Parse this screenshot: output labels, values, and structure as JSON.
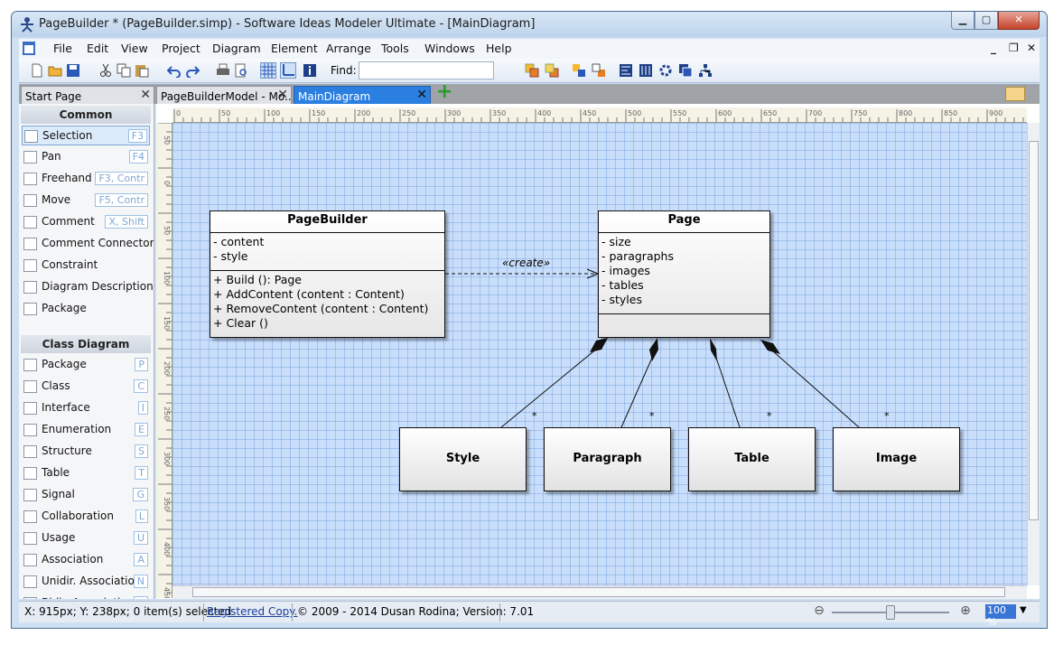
{
  "window": {
    "title": "PageBuilder * (PageBuilder.simp) - Software Ideas Modeler Ultimate - [MainDiagram]"
  },
  "menu": {
    "items": [
      "File",
      "Edit",
      "View",
      "Project",
      "Diagram",
      "Element",
      "Arrange",
      "Tools",
      "Windows",
      "Help"
    ],
    "mdi_min": "_",
    "mdi_restore": "❐",
    "mdi_close": "✕"
  },
  "toolbar": {
    "find_label": "Find:",
    "find_value": ""
  },
  "tabs": [
    {
      "label": "Start Page"
    },
    {
      "label": "PageBuilderModel - Mo..."
    },
    {
      "label": "MainDiagram"
    }
  ],
  "toolbox": {
    "common_header": "Common",
    "common": [
      {
        "label": "Selection",
        "key": "F3",
        "icon": "arrow-icon"
      },
      {
        "label": "Pan",
        "key": "F4",
        "icon": "pan-icon"
      },
      {
        "label": "Freehand Pa",
        "key": "F3, Contr",
        "icon": "freehand-icon"
      },
      {
        "label": "Move",
        "key": "F5, Contr",
        "icon": "move-icon"
      },
      {
        "label": "Comment",
        "key": "X, Shift",
        "icon": "comment-icon"
      },
      {
        "label": "Comment Connector",
        "key": "",
        "icon": "connector-icon"
      },
      {
        "label": "Constraint",
        "key": "",
        "icon": "constraint-icon"
      },
      {
        "label": "Diagram Description",
        "key": "",
        "icon": "description-icon"
      },
      {
        "label": "Package",
        "key": "",
        "icon": "package-icon"
      }
    ],
    "class_header": "Class Diagram",
    "class": [
      {
        "label": "Package",
        "key": "P",
        "icon": "package-icon"
      },
      {
        "label": "Class",
        "key": "C",
        "icon": "class-icon"
      },
      {
        "label": "Interface",
        "key": "I",
        "icon": "interface-icon"
      },
      {
        "label": "Enumeration",
        "key": "E",
        "icon": "enumeration-icon"
      },
      {
        "label": "Structure",
        "key": "S",
        "icon": "structure-icon"
      },
      {
        "label": "Table",
        "key": "T",
        "icon": "table-icon"
      },
      {
        "label": "Signal",
        "key": "G",
        "icon": "signal-icon"
      },
      {
        "label": "Collaboration",
        "key": "L",
        "icon": "collaboration-icon"
      },
      {
        "label": "Usage",
        "key": "U",
        "icon": "usage-icon"
      },
      {
        "label": "Association",
        "key": "A",
        "icon": "association-icon"
      },
      {
        "label": "Unidir. Association",
        "key": "N",
        "icon": "unidir-association-icon"
      },
      {
        "label": "Bidir. Association",
        "key": "B",
        "icon": "bidir-association-icon"
      }
    ]
  },
  "ruler": {
    "h": [
      "0",
      "50",
      "100",
      "150",
      "200",
      "250",
      "300",
      "350",
      "400",
      "450",
      "500",
      "550",
      "600",
      "650",
      "700",
      "750",
      "800",
      "850",
      "900"
    ],
    "v": [
      "50",
      "0",
      "50",
      "100",
      "150",
      "200",
      "250",
      "300",
      "350",
      "400",
      "450"
    ]
  },
  "diagram": {
    "pagebuilder": {
      "name": "PageBuilder",
      "attributes": [
        "- content",
        "- style"
      ],
      "operations": [
        "+ Build (): Page",
        "+ AddContent (content : Content)",
        "+ RemoveContent (content : Content)",
        "+ Clear ()"
      ]
    },
    "page": {
      "name": "Page",
      "attributes": [
        "- size",
        "- paragraphs",
        "- images",
        "- tables",
        "- styles"
      ]
    },
    "stereotype": "«create»",
    "subclasses": [
      "Style",
      "Paragraph",
      "Table",
      "Image"
    ],
    "multiplicity": "*"
  },
  "status": {
    "coords": "X: 915px; Y: 238px; 0 item(s) selected",
    "registered": "Registered Copy.",
    "copyright": "© 2009 - 2014 Dusan Rodina; Version: 7.01",
    "zoom": "100 %",
    "zoom_fraction": 0.5
  }
}
